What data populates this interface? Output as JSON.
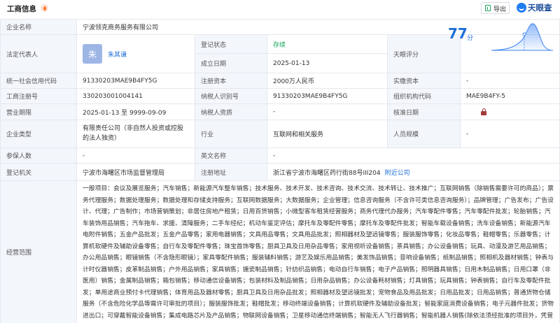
{
  "header": {
    "title": "工商信息",
    "export_label": "导出",
    "brand_label": "天眼查"
  },
  "company_name": {
    "label": "企业名称",
    "value": "宁波领克商务服务有限公司"
  },
  "legal_rep": {
    "label": "法定代表人",
    "avatar_char": "朱",
    "name": "朱其谦"
  },
  "reg_status": {
    "label": "登记状态",
    "value": "存续"
  },
  "established": {
    "label": "成立日期",
    "value": "2025-01-13"
  },
  "score": {
    "label": "天眼评分",
    "value": "77",
    "unit": "分"
  },
  "credit_code": {
    "label": "统一社会信用代码",
    "value": "91330203MAE9B4FY5G"
  },
  "reg_capital": {
    "label": "注册资本",
    "value": "2000万人民币"
  },
  "paid_capital": {
    "label": "实缴资本",
    "value": "-"
  },
  "reg_no": {
    "label": "工商注册号",
    "value": "330203001004141"
  },
  "taxpayer_id": {
    "label": "纳税人识别号",
    "value": "91330203MAE9B4FY5G"
  },
  "org_code": {
    "label": "组织机构代码",
    "value": "MAE9B4FY-5"
  },
  "biz_term": {
    "label": "营业期限",
    "value": "2025-01-13 至 9999-09-09"
  },
  "taxpayer_qual": {
    "label": "纳税人资质",
    "value": "-"
  },
  "approval_date": {
    "label": "核准日期"
  },
  "company_type": {
    "label": "企业类型",
    "value": "有限责任公司（非自然人投资或控股的法人独资）"
  },
  "industry": {
    "label": "行业",
    "value": "互联网和相关服务"
  },
  "staff_size": {
    "label": "人员规模",
    "value": "-"
  },
  "insured": {
    "label": "参保人数",
    "value": "-"
  },
  "english_name": {
    "label": "英文名称",
    "value": "-"
  },
  "registry": {
    "label": "登记机关",
    "value": "宁波市海曙区市场监督管理局"
  },
  "reg_address": {
    "label": "注册地址",
    "value": "浙江省宁波市海曙区药行街88号III204",
    "link": "附近公司"
  },
  "scope": {
    "label": "经营范围",
    "value": "一般项目：会议及展览服务；汽车销售；新能源汽车整车销售；技术服务、技术开发、技术咨询、技术交流、技术转让、技术推广；互联网销售（除销售需要许可的商品）；票务代理服务；数据处理服务；数据处理和存储支持服务；互联网数据服务；大数据服务；企业管理；信息咨询服务（不含许可类信息咨询服务）；品牌管理；广告发布；广告设计、代理；广告制作；市场营销策划；非居住房地产租赁；日用百货销售；小微型客车租赁经营服务；商务代理代办服务；汽车零配件零售；汽车零配件批发；轮胎销售；汽车装饰用品销售；汽车拖车、求援、清障服务；二手车经纪；机动车鉴定评估；摩托车及零配件零售；摩托车及零配件批发；智能车载设备销售；洗车设备销售；新能源汽车电附件销售；五金产品批发；五金产品零售；家用电器销售；文具用品零售；文具用品批发；照相器材及望远镜零售；服装服饰零售；化妆品零售；鞋帽零售；乐器零售；计算机软硬件及辅助设备零售；自行车及零配件零售；珠宝首饰零售；厨具卫具及日用杂品零售；家用视听设备销售；茶具销售；办公设备销售；玩具、动漫及游艺用品销售；办公用品销售；眼镜销售（不含隐形眼镜）；家具零配件销售；服装辅料销售；游艺及娱乐用品销售；美发饰品销售；音响设备销售；纸制品销售；照相机及器材销售；钟表与计时仪器销售；皮革制品销售；户外用品销售；家具销售；搪瓷制品销售；针纺织品销售；电动自行车销售；电子产品销售；照明器具销售；日用木制品销售；日用口罩（非医用）销售；金属制品销售；箱包销售；移动通信设备销售；包装材料及制品销售；日用杂品销售；办公设备耗材销售；灯具销售；玩具销售；钟表销售；自行车及零配件批发；单用途商业预付卡代理销售；体育用品及器材零售；厨具卫具及日用杂品批发；照相器材及望远镜批发；宠物食品及用品批发；日用品批发；日用品销售；普通货物仓储服务（不含危险化学品等需许可审批的项目）；服装服饰批发；鞋帽批发；移动终端设备销售；计算机软硬件及辅助设备批发；智能家庭消费设备销售；电子元器件批发；货物进出口；可穿戴智能设备销售；集成电路芯片及产品销售；物联网设备销售；卫星移动通信终端销售；智能无人飞行器销售；智能机器人销售(除依法须经批准的项目外，凭营业执照依法自主开展经营活动)。"
  }
}
